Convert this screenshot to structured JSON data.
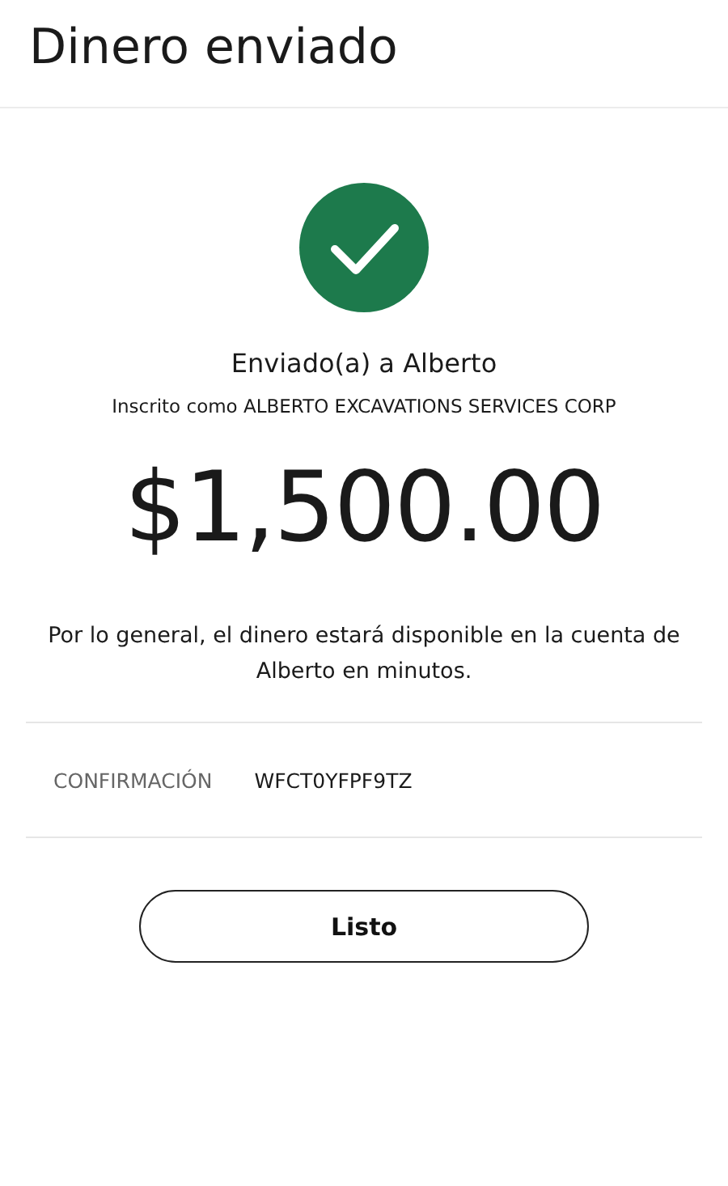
{
  "title": "Dinero enviado",
  "recipient": "Enviado(a) a Alberto",
  "enrolled_as": "Inscrito como ALBERTO EXCAVATIONS SERVICES CORP",
  "amount": "$1,500.00",
  "note": "Por lo general, el dinero estará disponible en la cuenta de Alberto en minutos.",
  "confirmation": {
    "label": "CONFIRMACIÓN",
    "value": "WFCT0YFPF9TZ"
  },
  "button": "Listo"
}
